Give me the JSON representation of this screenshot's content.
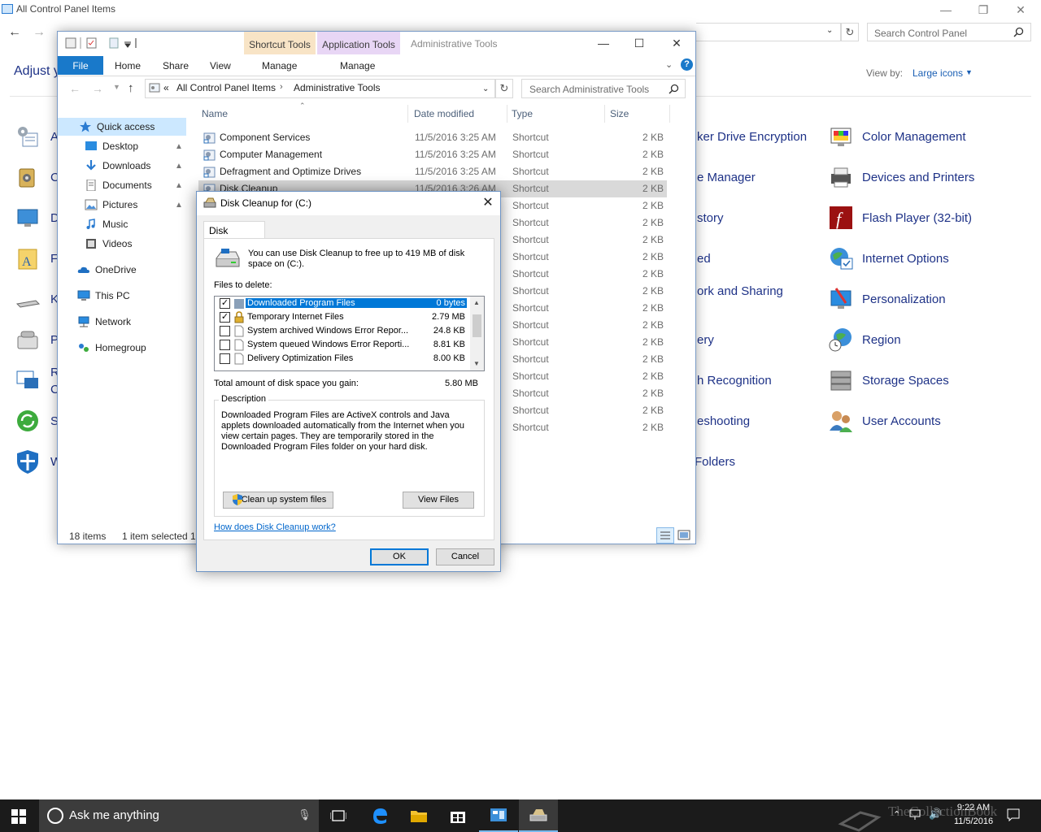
{
  "control_panel": {
    "window_title": "All Control Panel Items",
    "back_glyph": "←",
    "forward_glyph": "→",
    "refresh_glyph": "↻",
    "search_placeholder": "Search Control Panel",
    "heading": "Adjust y",
    "view_by_label": "View by:",
    "view_by_value": "Large icons",
    "left_partial_labels": [
      "A",
      "C",
      "D",
      "F",
      "K",
      "P",
      "R",
      "C",
      "S",
      "W"
    ],
    "middle_partial_labels": [
      "ker Drive Encryption",
      "e Manager",
      "story",
      "ed",
      "ork and Sharing",
      "ery",
      "h Recognition",
      "eshooting",
      "Folders"
    ],
    "right_items": [
      {
        "label": "Color Management",
        "icon": "color-management-icon"
      },
      {
        "label": "Devices and Printers",
        "icon": "devices-printers-icon"
      },
      {
        "label": "Flash Player (32-bit)",
        "icon": "flash-player-icon"
      },
      {
        "label": "Internet Options",
        "icon": "internet-options-icon"
      },
      {
        "label": "Personalization",
        "icon": "personalization-icon"
      },
      {
        "label": "Region",
        "icon": "region-icon"
      },
      {
        "label": "Storage Spaces",
        "icon": "storage-spaces-icon"
      },
      {
        "label": "User Accounts",
        "icon": "user-accounts-icon"
      }
    ]
  },
  "explorer": {
    "contextual_tab_1": "Shortcut Tools",
    "contextual_tab_2": "Application Tools",
    "window_title": "Administrative Tools",
    "ribbon_tabs": {
      "file": "File",
      "home": "Home",
      "share": "Share",
      "view": "View",
      "manage1": "Manage",
      "manage2": "Manage"
    },
    "address": {
      "prefix": "«",
      "crumb1": "All Control Panel Items",
      "separator": "›",
      "crumb2": "Administrative Tools"
    },
    "search_placeholder": "Search Administrative Tools",
    "nav": [
      {
        "label": "Quick access",
        "icon": "star-icon"
      },
      {
        "label": "Desktop",
        "icon": "desktop-icon",
        "pinned": true
      },
      {
        "label": "Downloads",
        "icon": "downloads-icon",
        "pinned": true
      },
      {
        "label": "Documents",
        "icon": "documents-icon",
        "pinned": true
      },
      {
        "label": "Pictures",
        "icon": "pictures-icon",
        "pinned": true
      },
      {
        "label": "Music",
        "icon": "music-icon"
      },
      {
        "label": "Videos",
        "icon": "videos-icon"
      },
      {
        "label": "OneDrive",
        "icon": "onedrive-icon"
      },
      {
        "label": "This PC",
        "icon": "this-pc-icon"
      },
      {
        "label": "Network",
        "icon": "network-icon"
      },
      {
        "label": "Homegroup",
        "icon": "homegroup-icon"
      }
    ],
    "columns": {
      "name": "Name",
      "date": "Date modified",
      "type": "Type",
      "size": "Size"
    },
    "rows": [
      {
        "name": "Component Services",
        "date": "11/5/2016 3:25 AM",
        "type": "Shortcut",
        "size": "2 KB"
      },
      {
        "name": "Computer Management",
        "date": "11/5/2016 3:25 AM",
        "type": "Shortcut",
        "size": "2 KB"
      },
      {
        "name": "Defragment and Optimize Drives",
        "date": "11/5/2016 3:25 AM",
        "type": "Shortcut",
        "size": "2 KB"
      },
      {
        "name": "Disk Cleanup",
        "date": "11/5/2016 3:26 AM",
        "type": "Shortcut",
        "size": "2 KB",
        "selected": true
      },
      {
        "name": "",
        "date": "",
        "type": "Shortcut",
        "size": "2 KB"
      },
      {
        "name": "",
        "date": "",
        "type": "Shortcut",
        "size": "2 KB"
      },
      {
        "name": "",
        "date": "",
        "type": "Shortcut",
        "size": "2 KB"
      },
      {
        "name": "",
        "date": "",
        "type": "Shortcut",
        "size": "2 KB"
      },
      {
        "name": "",
        "date": "",
        "type": "Shortcut",
        "size": "2 KB"
      },
      {
        "name": "",
        "date": "",
        "type": "Shortcut",
        "size": "2 KB"
      },
      {
        "name": "",
        "date": "",
        "type": "Shortcut",
        "size": "2 KB"
      },
      {
        "name": "",
        "date": "",
        "type": "Shortcut",
        "size": "2 KB"
      },
      {
        "name": "",
        "date": "",
        "type": "Shortcut",
        "size": "2 KB"
      },
      {
        "name": "",
        "date": "",
        "type": "Shortcut",
        "size": "2 KB"
      },
      {
        "name": "",
        "date": "",
        "type": "Shortcut",
        "size": "2 KB"
      },
      {
        "name": "",
        "date": "",
        "type": "Shortcut",
        "size": "2 KB"
      },
      {
        "name": "",
        "date": "",
        "type": "Shortcut",
        "size": "2 KB"
      },
      {
        "name": "",
        "date": "",
        "type": "Shortcut",
        "size": "2 KB"
      }
    ],
    "status_count": "18 items",
    "status_selected": "1 item selected",
    "status_extra": "1"
  },
  "dialog": {
    "title": "Disk Cleanup for  (C:)",
    "close_glyph": "✕",
    "tab": "Disk Cleanup",
    "intro": "You can use Disk Cleanup to free up to 419 MB of disk space on  (C:).",
    "files_label": "Files to delete:",
    "files": [
      {
        "name": "Downloaded Program Files",
        "size": "0 bytes",
        "checked": true,
        "selected": true,
        "icon": "folder-icon"
      },
      {
        "name": "Temporary Internet Files",
        "size": "2.79 MB",
        "checked": true,
        "icon": "lock-icon"
      },
      {
        "name": "System archived Windows Error Repor...",
        "size": "24.8 KB",
        "checked": false,
        "icon": "file-icon"
      },
      {
        "name": "System queued Windows Error Reporti...",
        "size": "8.81 KB",
        "checked": false,
        "icon": "file-icon"
      },
      {
        "name": "Delivery Optimization Files",
        "size": "8.00 KB",
        "checked": false,
        "icon": "file-icon"
      }
    ],
    "total_label": "Total amount of disk space you gain:",
    "total_value": "5.80 MB",
    "description_title": "Description",
    "description": "Downloaded Program Files are ActiveX controls and Java applets downloaded automatically from the Internet when you view certain pages. They are temporarily stored in the Downloaded Program Files folder on your hard disk.",
    "cleanup_system_button": "Clean up system files",
    "view_files_button": "View Files",
    "help_link": "How does Disk Cleanup work?",
    "ok_button": "OK",
    "cancel_button": "Cancel"
  },
  "taskbar": {
    "search_placeholder": "Ask me anything",
    "time": "9:22 AM",
    "date": "11/5/2016",
    "watermark": "TheCollectionBook"
  }
}
